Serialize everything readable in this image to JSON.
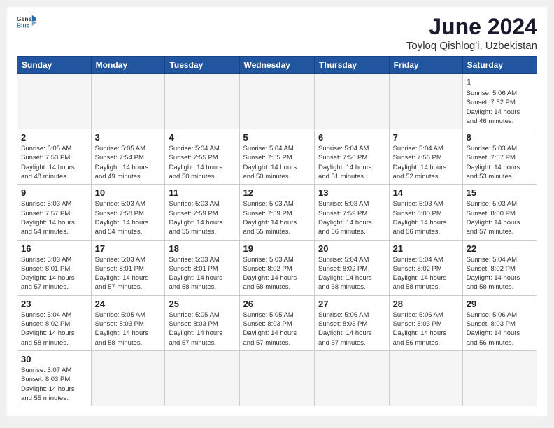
{
  "header": {
    "logo_general": "General",
    "logo_blue": "Blue",
    "title": "June 2024",
    "location": "Toyloq Qishlog'i, Uzbekistan"
  },
  "weekdays": [
    "Sunday",
    "Monday",
    "Tuesday",
    "Wednesday",
    "Thursday",
    "Friday",
    "Saturday"
  ],
  "days": [
    {
      "num": "",
      "info": ""
    },
    {
      "num": "",
      "info": ""
    },
    {
      "num": "",
      "info": ""
    },
    {
      "num": "",
      "info": ""
    },
    {
      "num": "",
      "info": ""
    },
    {
      "num": "",
      "info": ""
    },
    {
      "num": "1",
      "info": "Sunrise: 5:06 AM\nSunset: 7:52 PM\nDaylight: 14 hours\nand 46 minutes."
    },
    {
      "num": "2",
      "info": "Sunrise: 5:05 AM\nSunset: 7:53 PM\nDaylight: 14 hours\nand 48 minutes."
    },
    {
      "num": "3",
      "info": "Sunrise: 5:05 AM\nSunset: 7:54 PM\nDaylight: 14 hours\nand 49 minutes."
    },
    {
      "num": "4",
      "info": "Sunrise: 5:04 AM\nSunset: 7:55 PM\nDaylight: 14 hours\nand 50 minutes."
    },
    {
      "num": "5",
      "info": "Sunrise: 5:04 AM\nSunset: 7:55 PM\nDaylight: 14 hours\nand 50 minutes."
    },
    {
      "num": "6",
      "info": "Sunrise: 5:04 AM\nSunset: 7:56 PM\nDaylight: 14 hours\nand 51 minutes."
    },
    {
      "num": "7",
      "info": "Sunrise: 5:04 AM\nSunset: 7:56 PM\nDaylight: 14 hours\nand 52 minutes."
    },
    {
      "num": "8",
      "info": "Sunrise: 5:03 AM\nSunset: 7:57 PM\nDaylight: 14 hours\nand 53 minutes."
    },
    {
      "num": "9",
      "info": "Sunrise: 5:03 AM\nSunset: 7:57 PM\nDaylight: 14 hours\nand 54 minutes."
    },
    {
      "num": "10",
      "info": "Sunrise: 5:03 AM\nSunset: 7:58 PM\nDaylight: 14 hours\nand 54 minutes."
    },
    {
      "num": "11",
      "info": "Sunrise: 5:03 AM\nSunset: 7:59 PM\nDaylight: 14 hours\nand 55 minutes."
    },
    {
      "num": "12",
      "info": "Sunrise: 5:03 AM\nSunset: 7:59 PM\nDaylight: 14 hours\nand 55 minutes."
    },
    {
      "num": "13",
      "info": "Sunrise: 5:03 AM\nSunset: 7:59 PM\nDaylight: 14 hours\nand 56 minutes."
    },
    {
      "num": "14",
      "info": "Sunrise: 5:03 AM\nSunset: 8:00 PM\nDaylight: 14 hours\nand 56 minutes."
    },
    {
      "num": "15",
      "info": "Sunrise: 5:03 AM\nSunset: 8:00 PM\nDaylight: 14 hours\nand 57 minutes."
    },
    {
      "num": "16",
      "info": "Sunrise: 5:03 AM\nSunset: 8:01 PM\nDaylight: 14 hours\nand 57 minutes."
    },
    {
      "num": "17",
      "info": "Sunrise: 5:03 AM\nSunset: 8:01 PM\nDaylight: 14 hours\nand 57 minutes."
    },
    {
      "num": "18",
      "info": "Sunrise: 5:03 AM\nSunset: 8:01 PM\nDaylight: 14 hours\nand 58 minutes."
    },
    {
      "num": "19",
      "info": "Sunrise: 5:03 AM\nSunset: 8:02 PM\nDaylight: 14 hours\nand 58 minutes."
    },
    {
      "num": "20",
      "info": "Sunrise: 5:04 AM\nSunset: 8:02 PM\nDaylight: 14 hours\nand 58 minutes."
    },
    {
      "num": "21",
      "info": "Sunrise: 5:04 AM\nSunset: 8:02 PM\nDaylight: 14 hours\nand 58 minutes."
    },
    {
      "num": "22",
      "info": "Sunrise: 5:04 AM\nSunset: 8:02 PM\nDaylight: 14 hours\nand 58 minutes."
    },
    {
      "num": "23",
      "info": "Sunrise: 5:04 AM\nSunset: 8:02 PM\nDaylight: 14 hours\nand 58 minutes."
    },
    {
      "num": "24",
      "info": "Sunrise: 5:05 AM\nSunset: 8:03 PM\nDaylight: 14 hours\nand 58 minutes."
    },
    {
      "num": "25",
      "info": "Sunrise: 5:05 AM\nSunset: 8:03 PM\nDaylight: 14 hours\nand 57 minutes."
    },
    {
      "num": "26",
      "info": "Sunrise: 5:05 AM\nSunset: 8:03 PM\nDaylight: 14 hours\nand 57 minutes."
    },
    {
      "num": "27",
      "info": "Sunrise: 5:06 AM\nSunset: 8:03 PM\nDaylight: 14 hours\nand 57 minutes."
    },
    {
      "num": "28",
      "info": "Sunrise: 5:06 AM\nSunset: 8:03 PM\nDaylight: 14 hours\nand 56 minutes."
    },
    {
      "num": "29",
      "info": "Sunrise: 5:06 AM\nSunset: 8:03 PM\nDaylight: 14 hours\nand 56 minutes."
    },
    {
      "num": "30",
      "info": "Sunrise: 5:07 AM\nSunset: 8:03 PM\nDaylight: 14 hours\nand 55 minutes."
    }
  ]
}
